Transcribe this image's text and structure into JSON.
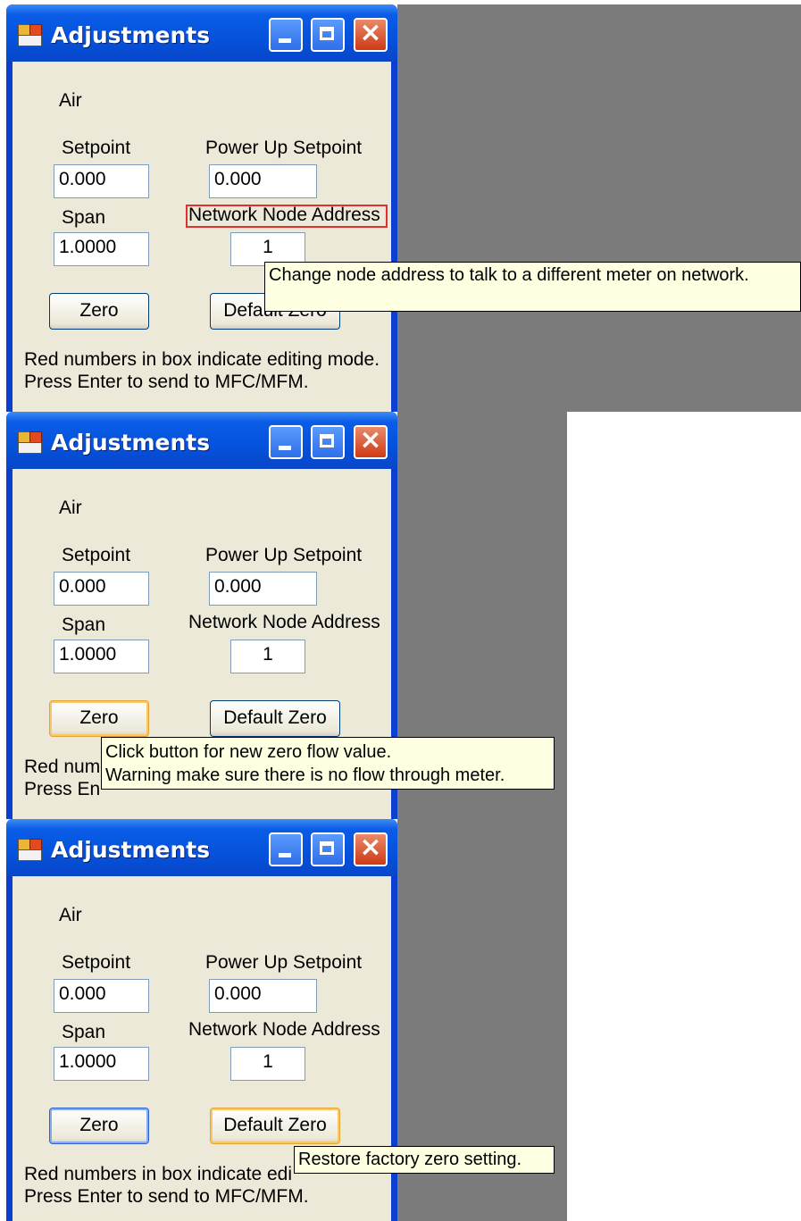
{
  "panels": [
    {
      "window": {
        "title": "Adjustments"
      },
      "gas_label": "Air",
      "setpoint": {
        "label": "Setpoint",
        "value": "0.000"
      },
      "power_up_setpoint": {
        "label": "Power Up Setpoint",
        "value": "0.000"
      },
      "span": {
        "label": "Span",
        "value": "1.0000"
      },
      "network_node_address": {
        "label": "Network Node Address",
        "value": "1"
      },
      "zero_button": "Zero",
      "default_zero_button": "Default Zero",
      "hint_line1": "Red numbers in box indicate editing mode.",
      "hint_line2": "Press Enter to send to MFC/MFM.",
      "tooltip": {
        "lines": [
          "Change node address to talk to a different meter on network."
        ]
      }
    },
    {
      "window": {
        "title": "Adjustments"
      },
      "gas_label": "Air",
      "setpoint": {
        "label": "Setpoint",
        "value": "0.000"
      },
      "power_up_setpoint": {
        "label": "Power Up Setpoint",
        "value": "0.000"
      },
      "span": {
        "label": "Span",
        "value": "1.0000"
      },
      "network_node_address": {
        "label": "Network Node Address",
        "value": "1"
      },
      "zero_button": "Zero",
      "default_zero_button": "Default Zero",
      "hint_line1": "Red num",
      "hint_line2": "Press En",
      "tooltip": {
        "lines": [
          "Click button for new zero flow value.",
          "Warning  make sure there is no flow through meter."
        ]
      }
    },
    {
      "window": {
        "title": "Adjustments"
      },
      "gas_label": "Air",
      "setpoint": {
        "label": "Setpoint",
        "value": "0.000"
      },
      "power_up_setpoint": {
        "label": "Power Up Setpoint",
        "value": "0.000"
      },
      "span": {
        "label": "Span",
        "value": "1.0000"
      },
      "network_node_address": {
        "label": "Network Node Address",
        "value": "1"
      },
      "zero_button": "Zero",
      "default_zero_button": "Default Zero",
      "hint_line1": "Red numbers in box indicate edi",
      "hint_line2": "Press Enter to send to MFC/MFM.",
      "tooltip": {
        "lines": [
          "Restore factory zero setting."
        ]
      }
    }
  ],
  "colors": {
    "titlebar": "#0552dc",
    "client": "#ece9d8",
    "tooltip": "#ffffe1",
    "highlight": "#e03030",
    "desktop": "#7b7b7b"
  }
}
